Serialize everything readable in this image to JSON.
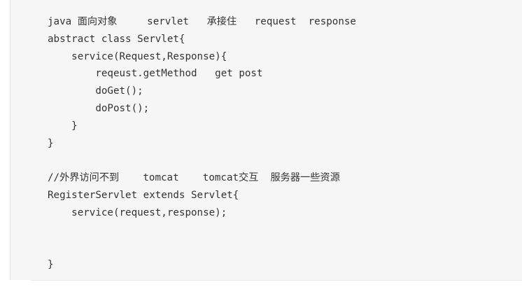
{
  "code": {
    "lines": [
      "java 面向对象     servlet   承接住   request  response",
      "abstract class Servlet{",
      "    service(Request,Response){",
      "        reqeust.getMethod   get post",
      "        doGet();",
      "        doPost();",
      "    }",
      "}",
      "",
      "//外界访问不到    tomcat    tomcat交互  服务器一些资源",
      "RegisterServlet extends Servlet{",
      "    service(request,response);",
      "",
      "",
      "}"
    ]
  }
}
